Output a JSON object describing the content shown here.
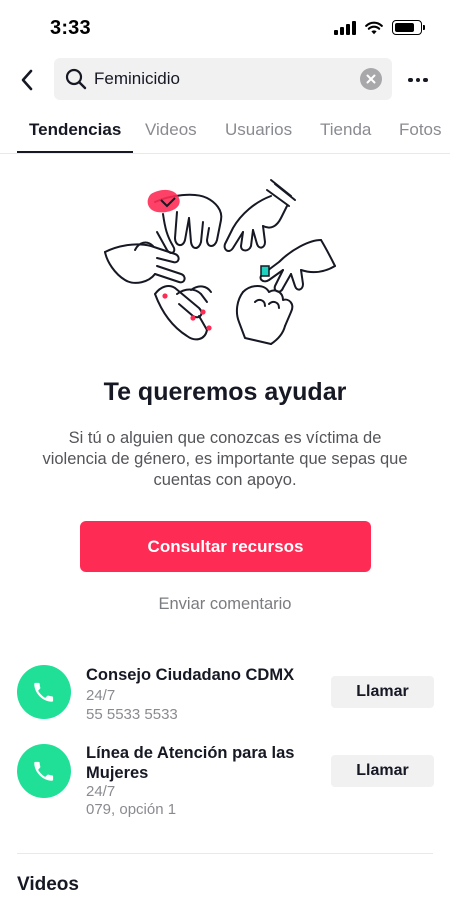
{
  "status_bar": {
    "time": "3:33"
  },
  "search": {
    "query": "Feminicidio"
  },
  "tabs": [
    {
      "label": "Tendencias",
      "active": true
    },
    {
      "label": "Videos"
    },
    {
      "label": "Usuarios"
    },
    {
      "label": "Tienda"
    },
    {
      "label": "Fotos"
    }
  ],
  "help": {
    "title": "Te queremos ayudar",
    "description": "Si tú o alguien que conozcas es víctima de violencia de género, es importante que sepas que cuentas con apoyo.",
    "resources_button": "Consultar recursos",
    "feedback_link": "Enviar comentario"
  },
  "contacts": [
    {
      "name": "Consejo Ciudadano CDMX",
      "hours": "24/7",
      "phone": "55 5533 5533",
      "action": "Llamar"
    },
    {
      "name": "Línea de Atención para las Mujeres",
      "hours": "24/7",
      "phone": "079, opción 1",
      "action": "Llamar"
    }
  ],
  "sections": {
    "videos_title": "Videos"
  },
  "colors": {
    "accent": "#fe2c55",
    "phone_green": "#1fe096",
    "text": "#161823",
    "muted": "#8a8b91"
  },
  "icons": [
    "signal-icon",
    "wifi-icon",
    "battery-icon",
    "back-arrow-icon",
    "search-icon",
    "clear-icon",
    "more-icon",
    "phone-icon"
  ]
}
